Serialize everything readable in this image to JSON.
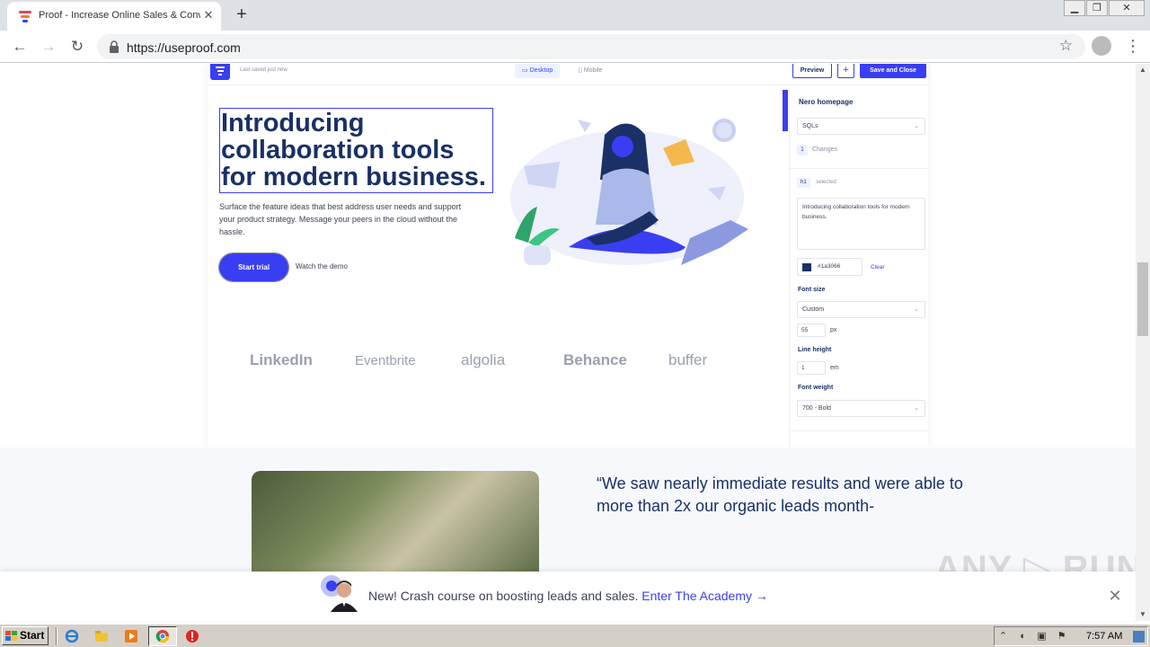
{
  "browser": {
    "tab_title": "Proof - Increase Online Sales & Conv",
    "tab_close": "✕",
    "new_tab": "+",
    "url": "https://useproof.com",
    "window_buttons": [
      "▁",
      "❐",
      "✕"
    ]
  },
  "editor": {
    "last_saved": "Last saved just now",
    "device_tabs": [
      "Desktop",
      "Mobile"
    ],
    "preview_label": "Preview",
    "plus_label": "+",
    "save_label": "Save and Close",
    "hero": {
      "headline": "Introducing collaboration tools for modern business.",
      "subtext": "Surface the feature ideas that best address user needs and support your product strategy. Message your peers in the cloud without the hassle.",
      "cta_primary": "Start trial",
      "cta_secondary": "Watch the demo"
    },
    "logos": [
      "LinkedIn",
      "Eventbrite",
      "algolia",
      "Behance",
      "buffer"
    ],
    "panel": {
      "title": "Nero homepage",
      "segment": "SQLs",
      "changes_count": "1",
      "changes_label": "Changes",
      "tag": "h1",
      "tag_state": "selected",
      "text_value": "Introducing collaboration tools for modern business.",
      "color_hex": "#1a3066",
      "clear_label": "Clear",
      "font_size_label": "Font size",
      "font_size_mode": "Custom",
      "font_size_value": "55",
      "font_size_unit": "px",
      "line_height_label": "Line height",
      "line_height_value": "1",
      "line_height_unit": "em",
      "font_weight_label": "Font weight",
      "font_weight_value": "700 - Bold"
    }
  },
  "testimonial": {
    "quote": "“We saw nearly immediate results and were able to more than 2x our organic leads month-"
  },
  "banner": {
    "text": "New! Crash course on boosting leads and sales.",
    "link": "Enter The Academy →",
    "close": "✕"
  },
  "watermark": "ANY ▷ RUN",
  "taskbar": {
    "start_label": "Start",
    "clock": "7:57 AM"
  },
  "colors": {
    "brand": "#3a3ef2",
    "navy": "#1a3066"
  }
}
